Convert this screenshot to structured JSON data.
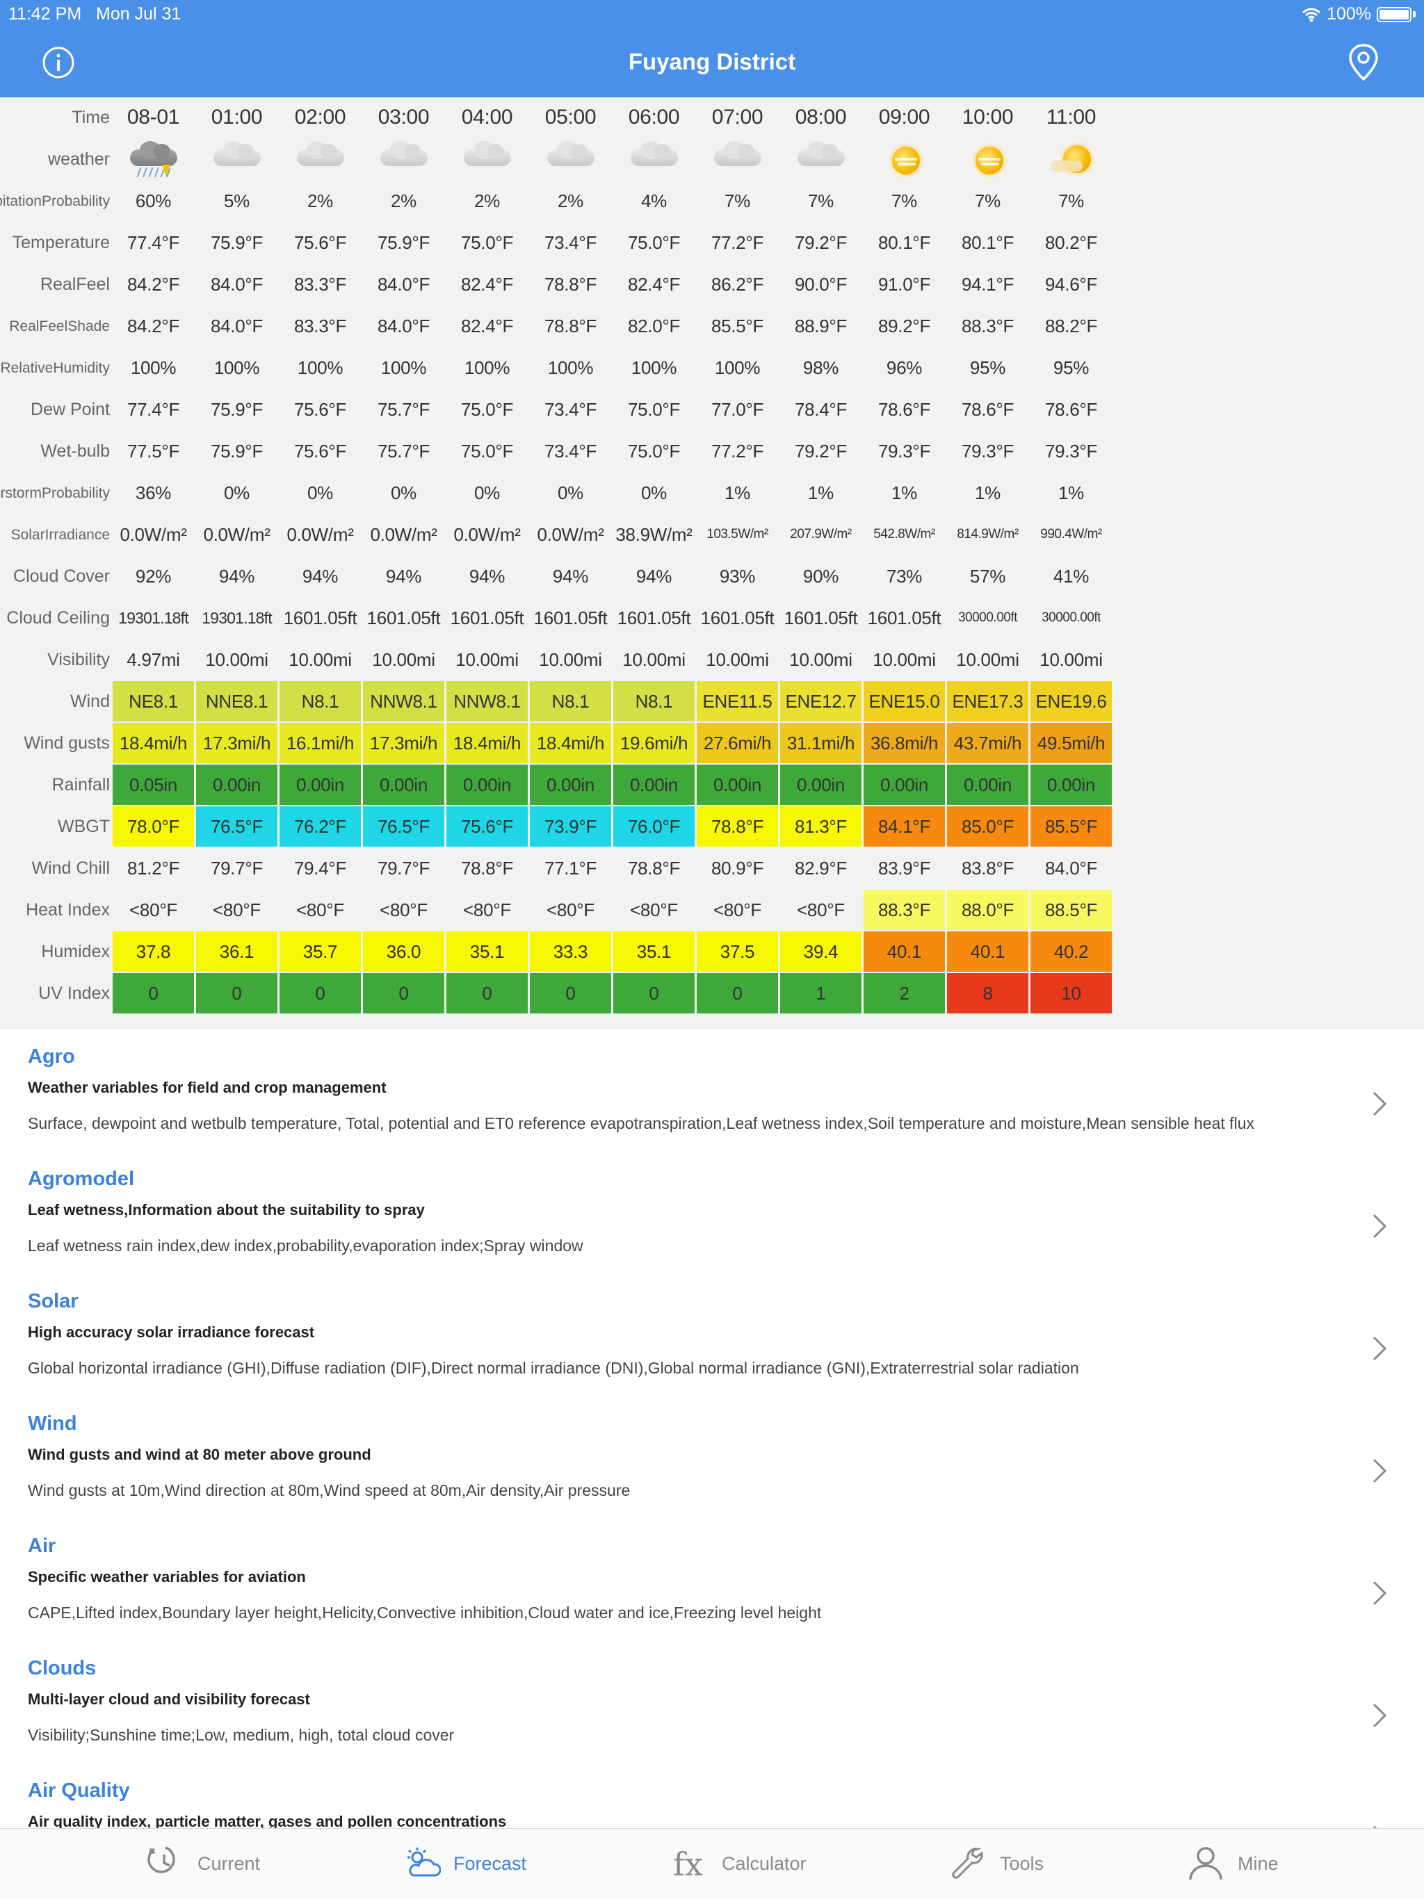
{
  "status": {
    "time": "11:42 PM",
    "date": "Mon Jul 31",
    "battery": "100%"
  },
  "header": {
    "title": "Fuyang District"
  },
  "table": {
    "columns": [
      "08-01",
      "01:00",
      "02:00",
      "03:00",
      "04:00",
      "05:00",
      "06:00",
      "07:00",
      "08:00",
      "09:00",
      "10:00",
      "11:00"
    ],
    "weather": [
      "thunderstorm-rain-icon",
      "cloudy-icon",
      "cloudy-icon",
      "cloudy-icon",
      "cloudy-icon",
      "cloudy-icon",
      "cloudy-icon",
      "cloudy-icon",
      "cloudy-icon",
      "hazy-sun-icon",
      "hazy-sun-icon",
      "partly-sunny-icon"
    ],
    "rows": [
      {
        "label": [
          "Time"
        ],
        "kind": "time"
      },
      {
        "label": [
          "weather"
        ],
        "kind": "weather"
      },
      {
        "label": [
          "Precipitation",
          "Probability"
        ],
        "values": [
          "60%",
          "5%",
          "2%",
          "2%",
          "2%",
          "2%",
          "4%",
          "7%",
          "7%",
          "7%",
          "7%",
          "7%"
        ]
      },
      {
        "label": [
          "Temperature"
        ],
        "values": [
          "77.4°F",
          "75.9°F",
          "75.6°F",
          "75.9°F",
          "75.0°F",
          "73.4°F",
          "75.0°F",
          "77.2°F",
          "79.2°F",
          "80.1°F",
          "80.1°F",
          "80.2°F"
        ]
      },
      {
        "label": [
          "RealFeel"
        ],
        "values": [
          "84.2°F",
          "84.0°F",
          "83.3°F",
          "84.0°F",
          "82.4°F",
          "78.8°F",
          "82.4°F",
          "86.2°F",
          "90.0°F",
          "91.0°F",
          "94.1°F",
          "94.6°F"
        ]
      },
      {
        "label": [
          "RealFeel",
          "Shade"
        ],
        "values": [
          "84.2°F",
          "84.0°F",
          "83.3°F",
          "84.0°F",
          "82.4°F",
          "78.8°F",
          "82.0°F",
          "85.5°F",
          "88.9°F",
          "89.2°F",
          "88.3°F",
          "88.2°F"
        ]
      },
      {
        "label": [
          "Relative",
          "Humidity"
        ],
        "values": [
          "100%",
          "100%",
          "100%",
          "100%",
          "100%",
          "100%",
          "100%",
          "100%",
          "98%",
          "96%",
          "95%",
          "95%"
        ]
      },
      {
        "label": [
          "Dew Point"
        ],
        "values": [
          "77.4°F",
          "75.9°F",
          "75.6°F",
          "75.7°F",
          "75.0°F",
          "73.4°F",
          "75.0°F",
          "77.0°F",
          "78.4°F",
          "78.6°F",
          "78.6°F",
          "78.6°F"
        ]
      },
      {
        "label": [
          "Wet-bulb"
        ],
        "values": [
          "77.5°F",
          "75.9°F",
          "75.6°F",
          "75.7°F",
          "75.0°F",
          "73.4°F",
          "75.0°F",
          "77.2°F",
          "79.2°F",
          "79.3°F",
          "79.3°F",
          "79.3°F"
        ]
      },
      {
        "label": [
          "Thunderstorm",
          "Probability"
        ],
        "values": [
          "36%",
          "0%",
          "0%",
          "0%",
          "0%",
          "0%",
          "0%",
          "1%",
          "1%",
          "1%",
          "1%",
          "1%"
        ]
      },
      {
        "label": [
          "Solar",
          "Irradiance"
        ],
        "values": [
          "0.0W/m²",
          "0.0W/m²",
          "0.0W/m²",
          "0.0W/m²",
          "0.0W/m²",
          "0.0W/m²",
          "38.9W/m²",
          "103.5W/m²",
          "207.9W/m²",
          "542.8W/m²",
          "814.9W/m²",
          "990.4W/m²"
        ],
        "size": [
          "",
          "",
          "",
          "",
          "",
          "",
          "",
          "xs",
          "xs",
          "xs",
          "xs",
          "xs"
        ]
      },
      {
        "label": [
          "Cloud Cover"
        ],
        "values": [
          "92%",
          "94%",
          "94%",
          "94%",
          "94%",
          "94%",
          "94%",
          "93%",
          "90%",
          "73%",
          "57%",
          "41%"
        ]
      },
      {
        "label": [
          "Cloud Ceiling"
        ],
        "values": [
          "19301.18ft",
          "19301.18ft",
          "1601.05ft",
          "1601.05ft",
          "1601.05ft",
          "1601.05ft",
          "1601.05ft",
          "1601.05ft",
          "1601.05ft",
          "1601.05ft",
          "30000.00ft",
          "30000.00ft"
        ],
        "size": [
          "sm",
          "sm",
          "",
          "",
          "",
          "",
          "",
          "",
          "",
          "",
          "xs",
          "xs"
        ]
      },
      {
        "label": [
          "Visibility"
        ],
        "values": [
          "4.97mi",
          "10.00mi",
          "10.00mi",
          "10.00mi",
          "10.00mi",
          "10.00mi",
          "10.00mi",
          "10.00mi",
          "10.00mi",
          "10.00mi",
          "10.00mi",
          "10.00mi"
        ]
      },
      {
        "label": [
          "Wind"
        ],
        "values": [
          "NE8.1",
          "NNE8.1",
          "N8.1",
          "NNW8.1",
          "NNW8.1",
          "N8.1",
          "N8.1",
          "ENE11.5",
          "ENE12.7",
          "ENE15.0",
          "ENE17.3",
          "ENE19.6"
        ],
        "colors": [
          "#d2e045",
          "#d2e045",
          "#d2e045",
          "#d2e045",
          "#d2e045",
          "#d2e045",
          "#d2e045",
          "#ebe030",
          "#ebe030",
          "#f0d21e",
          "#f0d21e",
          "#f0d21e"
        ]
      },
      {
        "label": [
          "Wind gusts"
        ],
        "values": [
          "18.4mi/h",
          "17.3mi/h",
          "16.1mi/h",
          "17.3mi/h",
          "18.4mi/h",
          "18.4mi/h",
          "19.6mi/h",
          "27.6mi/h",
          "31.1mi/h",
          "36.8mi/h",
          "43.7mi/h",
          "49.5mi/h"
        ],
        "colors": [
          "#e8e81e",
          "#e8e81e",
          "#e8e81e",
          "#e8e81e",
          "#e8e81e",
          "#e8e81e",
          "#e8e81e",
          "#edc71c",
          "#edc71c",
          "#eeaa18",
          "#eeaa18",
          "#eda016"
        ]
      },
      {
        "label": [
          "Rainfall"
        ],
        "values": [
          "0.05in",
          "0.00in",
          "0.00in",
          "0.00in",
          "0.00in",
          "0.00in",
          "0.00in",
          "0.00in",
          "0.00in",
          "0.00in",
          "0.00in",
          "0.00in"
        ],
        "colors": [
          "#3fa83a",
          "#3fa83a",
          "#3fa83a",
          "#3fa83a",
          "#3fa83a",
          "#3fa83a",
          "#3fa83a",
          "#3fa83a",
          "#3fa83a",
          "#3fa83a",
          "#3fa83a",
          "#3fa83a"
        ]
      },
      {
        "label": [
          "WBGT"
        ],
        "values": [
          "78.0°F",
          "76.5°F",
          "76.2°F",
          "76.5°F",
          "75.6°F",
          "73.9°F",
          "76.0°F",
          "78.8°F",
          "81.3°F",
          "84.1°F",
          "85.0°F",
          "85.5°F"
        ],
        "colors": [
          "#f7f700",
          "#1fd6e6",
          "#1fd6e6",
          "#1fd6e6",
          "#1fd6e6",
          "#1fd6e6",
          "#1fd6e6",
          "#f7f700",
          "#f7f700",
          "#f78a0e",
          "#f78a0e",
          "#f78a0e"
        ]
      },
      {
        "label": [
          "Wind Chill"
        ],
        "values": [
          "81.2°F",
          "79.7°F",
          "79.4°F",
          "79.7°F",
          "78.8°F",
          "77.1°F",
          "78.8°F",
          "80.9°F",
          "82.9°F",
          "83.9°F",
          "83.8°F",
          "84.0°F"
        ]
      },
      {
        "label": [
          "Heat Index"
        ],
        "values": [
          "<80°F",
          "<80°F",
          "<80°F",
          "<80°F",
          "<80°F",
          "<80°F",
          "<80°F",
          "<80°F",
          "<80°F",
          "88.3°F",
          "88.0°F",
          "88.5°F"
        ],
        "colors": [
          "",
          "",
          "",
          "",
          "",
          "",
          "",
          "",
          "",
          "#f7f760",
          "#f7f760",
          "#f7f760"
        ]
      },
      {
        "label": [
          "Humidex"
        ],
        "values": [
          "37.8",
          "36.1",
          "35.7",
          "36.0",
          "35.1",
          "33.3",
          "35.1",
          "37.5",
          "39.4",
          "40.1",
          "40.1",
          "40.2"
        ],
        "colors": [
          "#f7f700",
          "#f7f700",
          "#f7f700",
          "#f7f700",
          "#f7f700",
          "#f7f700",
          "#f7f700",
          "#f7f700",
          "#f7f700",
          "#f78a0e",
          "#f78a0e",
          "#f78a0e"
        ]
      },
      {
        "label": [
          "UV Index"
        ],
        "values": [
          "0",
          "0",
          "0",
          "0",
          "0",
          "0",
          "0",
          "0",
          "1",
          "2",
          "8",
          "10"
        ],
        "colors": [
          "#3fa83a",
          "#3fa83a",
          "#3fa83a",
          "#3fa83a",
          "#3fa83a",
          "#3fa83a",
          "#3fa83a",
          "#3fa83a",
          "#3fa83a",
          "#3fa83a",
          "#e8391c",
          "#e8391c"
        ]
      }
    ]
  },
  "list": [
    {
      "title": "Agro",
      "subtitle": "Weather variables for field and crop management",
      "desc": "Surface, dewpoint and wetbulb temperature, Total, potential and ET0 reference evapotranspiration,Leaf wetness index,Soil temperature and moisture,Mean sensible heat flux"
    },
    {
      "title": "Agromodel",
      "subtitle": "Leaf wetness,Information about the suitability to spray",
      "desc": "Leaf wetness rain index,dew index,probability,evaporation index;Spray window"
    },
    {
      "title": "Solar",
      "subtitle": "High accuracy solar irradiance forecast",
      "desc": "Global horizontal irradiance (GHI),Diffuse radiation (DIF),Direct normal irradiance (DNI),Global normal irradiance (GNI),Extraterrestrial solar radiation"
    },
    {
      "title": "Wind",
      "subtitle": "Wind gusts and wind at 80 meter above ground",
      "desc": "Wind gusts at 10m,Wind direction at 80m,Wind speed at 80m,Air density,Air pressure"
    },
    {
      "title": "Air",
      "subtitle": "Specific weather variables for aviation",
      "desc": "CAPE,Lifted index,Boundary layer height,Helicity,Convective inhibition,Cloud water and ice,Freezing level height"
    },
    {
      "title": "Clouds",
      "subtitle": "Multi-layer cloud and visibility forecast",
      "desc": "Visibility;Sunshine time;Low, medium, high, total cloud cover"
    },
    {
      "title": "Air Quality",
      "subtitle": "Air quality index, particle matter, gases and pollen concentrations",
      "desc": ""
    }
  ],
  "tabs": [
    {
      "label": "Current",
      "icon": "refresh-clock-icon",
      "active": false
    },
    {
      "label": "Forecast",
      "icon": "sun-cloud-icon",
      "active": true
    },
    {
      "label": "Calculator",
      "icon": "fx-icon",
      "active": false
    },
    {
      "label": "Tools",
      "icon": "wrench-icon",
      "active": false
    },
    {
      "label": "Mine",
      "icon": "person-icon",
      "active": false
    }
  ],
  "colors": {
    "header": "#4a8fe8",
    "accent": "#3b82dc"
  }
}
